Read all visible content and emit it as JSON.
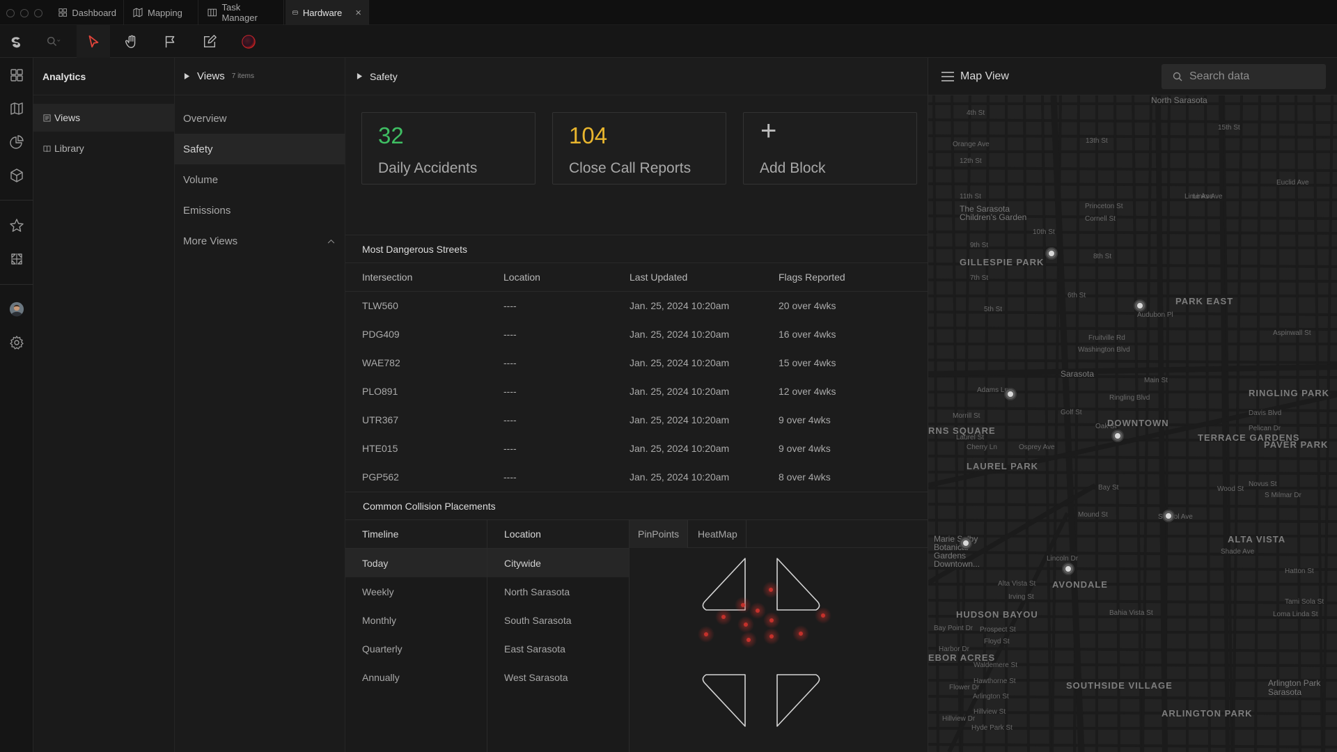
{
  "window": {
    "tabs": [
      {
        "label": "Dashboard",
        "icon": "grid-icon"
      },
      {
        "label": "Mapping",
        "icon": "map-icon"
      },
      {
        "label": "Task Manager",
        "icon": "columns-icon"
      },
      {
        "label": "Hardware",
        "icon": "hardware-icon",
        "active": true
      }
    ],
    "close_glyph": "×"
  },
  "toolbar": {
    "tools": [
      "zoom-icon",
      "pointer-icon",
      "hand-icon",
      "flag-icon",
      "edit-icon",
      "record-icon"
    ],
    "active_tool_color": "#e0443a"
  },
  "rail": {
    "items": [
      "grid-icon",
      "map-icon",
      "chart-pie-icon",
      "cube-icon",
      "star-icon",
      "layout-icon",
      "avatar",
      "gear-icon"
    ]
  },
  "analytics": {
    "title": "Analytics",
    "items": [
      {
        "label": "Views",
        "selected": true
      },
      {
        "label": "Library",
        "selected": false
      }
    ]
  },
  "views": {
    "title": "Views",
    "count": "7 items",
    "items": [
      "Overview",
      "Safety",
      "Volume",
      "Emissions"
    ],
    "more": "More Views",
    "selected": "Safety"
  },
  "main": {
    "breadcrumb": "Safety",
    "cards": [
      {
        "value": "32",
        "label": "Daily Accidents",
        "color": "#3fbf63"
      },
      {
        "value": "104",
        "label": "Close Call Reports",
        "color": "#e8b52e"
      },
      {
        "value": "+",
        "label": "Add Block",
        "color": "#bdbdbd"
      }
    ],
    "streets": {
      "title": "Most Dangerous Streets",
      "columns": [
        "Intersection",
        "Location",
        "Last Updated",
        "Flags Reported"
      ],
      "rows": [
        [
          "TLW560",
          "----",
          "Jan. 25, 2024 10:20am",
          "20 over 4wks"
        ],
        [
          "PDG409",
          "----",
          "Jan. 25, 2024 10:20am",
          "16 over 4wks"
        ],
        [
          "WAE782",
          "----",
          "Jan. 25, 2024 10:20am",
          "15 over 4wks"
        ],
        [
          "PLO891",
          "----",
          "Jan. 25, 2024 10:20am",
          "12 over 4wks"
        ],
        [
          "UTR367",
          "----",
          "Jan. 25, 2024 10:20am",
          "9 over 4wks"
        ],
        [
          "HTE015",
          "----",
          "Jan. 25, 2024 10:20am",
          "9 over 4wks"
        ],
        [
          "PGP562",
          "----",
          "Jan. 25, 2024 10:20am",
          "8 over 4wks"
        ]
      ]
    },
    "collisions": {
      "title": "Common Collision Placements",
      "timeline_header": "Timeline",
      "timeline": [
        "Today",
        "Weekly",
        "Monthly",
        "Quarterly",
        "Annually"
      ],
      "location_header": "Location",
      "locations": [
        "Citywide",
        "North Sarasota",
        "South Sarasota",
        "East Sarasota",
        "West Sarasota"
      ],
      "modes": [
        "PinPoints",
        "HeatMap"
      ],
      "hotspot_color": "#c4312b"
    }
  },
  "map": {
    "title": "Map View",
    "search_placeholder": "Search data",
    "labels": {
      "areas": [
        "GILLESPIE PARK",
        "PARK EAST",
        "DOWNTOWN",
        "RINGLING PARK",
        "TERRACE GARDENS",
        "PAVER PARK",
        "LAUREL PARK",
        "AVONDALE",
        "ALTA VISTA",
        "HUDSON BAYOU",
        "SOUTHSIDE VILLAGE",
        "ARLINGTON PARK",
        "RNS SQUARE",
        "EBOR ACRES"
      ],
      "places": [
        "The Sarasota Children's Garden",
        "Sarasota",
        "North Sarasota",
        "Marie Selby Botanical Gardens Downtown...",
        "Arlington Park Sarasota"
      ],
      "streets": [
        "4th St",
        "12th St",
        "13th St",
        "15th St",
        "11th St",
        "10th St",
        "9th St",
        "8th St",
        "7th St",
        "6th St",
        "5th St",
        "Fruitville Rd",
        "Main St",
        "Ringling Blvd",
        "Adams Ln",
        "Oak St",
        "Wood St",
        "Novus St",
        "Bay St",
        "Mound St",
        "Bahia Vista St",
        "Prospect St",
        "Floyd St",
        "Waldemere St",
        "Hawthorne St",
        "Arlington St",
        "Hillview St",
        "Hyde Park St",
        "Washington Blvd",
        "Orange Ave",
        "Lime Ave",
        "Osprey Ave",
        "School Ave",
        "Shade Ave",
        "Laurel St",
        "Morrill St",
        "Golf St",
        "Aspinwall St",
        "Davis Blvd",
        "Pelican Dr",
        "Hatton St",
        "Tami Sola St",
        "Loma Linda St",
        "Alta Vista St",
        "Irving St",
        "Cornell St",
        "Princeton St",
        "Audubon Pl",
        "Cherry Ln",
        "Lincoln Dr",
        "Bay Point Dr",
        "Harbor Dr",
        "Flower Dr",
        "Hillview Dr",
        "Euclid Ave",
        "Links Ave",
        "S Milmar Dr"
      ]
    }
  }
}
